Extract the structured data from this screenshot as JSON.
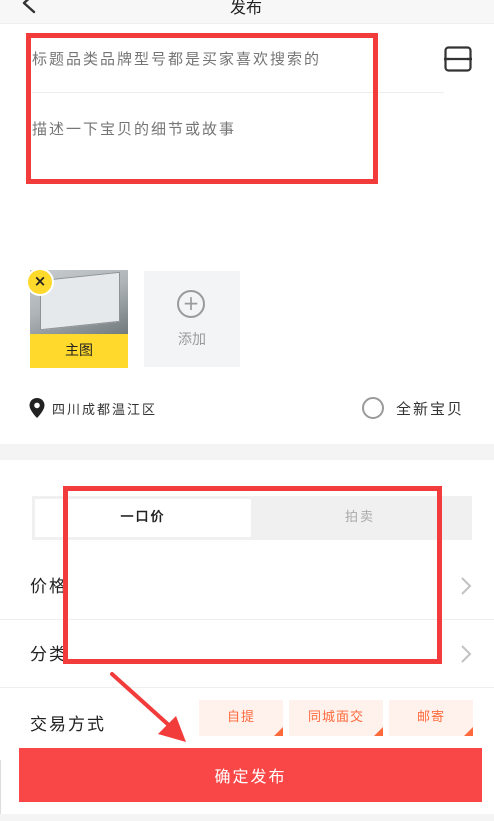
{
  "header": {
    "title": "发布"
  },
  "editor": {
    "title_placeholder": "标题品类品牌型号都是买家喜欢搜索的",
    "description_placeholder": "描述一下宝贝的细节或故事"
  },
  "photos": {
    "main_label": "主图",
    "add_label": "添加",
    "remove_symbol": "×"
  },
  "location": {
    "text": "四川成都温江区"
  },
  "new_item": {
    "label": "全新宝贝",
    "checked": false
  },
  "pricing": {
    "tabs": [
      {
        "label": "一口价",
        "active": true
      },
      {
        "label": "拍卖",
        "active": false
      }
    ],
    "rows": [
      {
        "label": "价格"
      },
      {
        "label": "分类"
      }
    ]
  },
  "trade": {
    "label": "交易方式",
    "options": [
      {
        "label": "自提"
      },
      {
        "label": "同城面交"
      },
      {
        "label": "邮寄"
      }
    ]
  },
  "submit": {
    "label": "确定发布"
  },
  "colors": {
    "accent": "#ffd92b",
    "submit": "#f94646",
    "annotation": "#f23b3b",
    "chip_text": "#ff6a3d",
    "chip_bg": "#fff1ec"
  }
}
